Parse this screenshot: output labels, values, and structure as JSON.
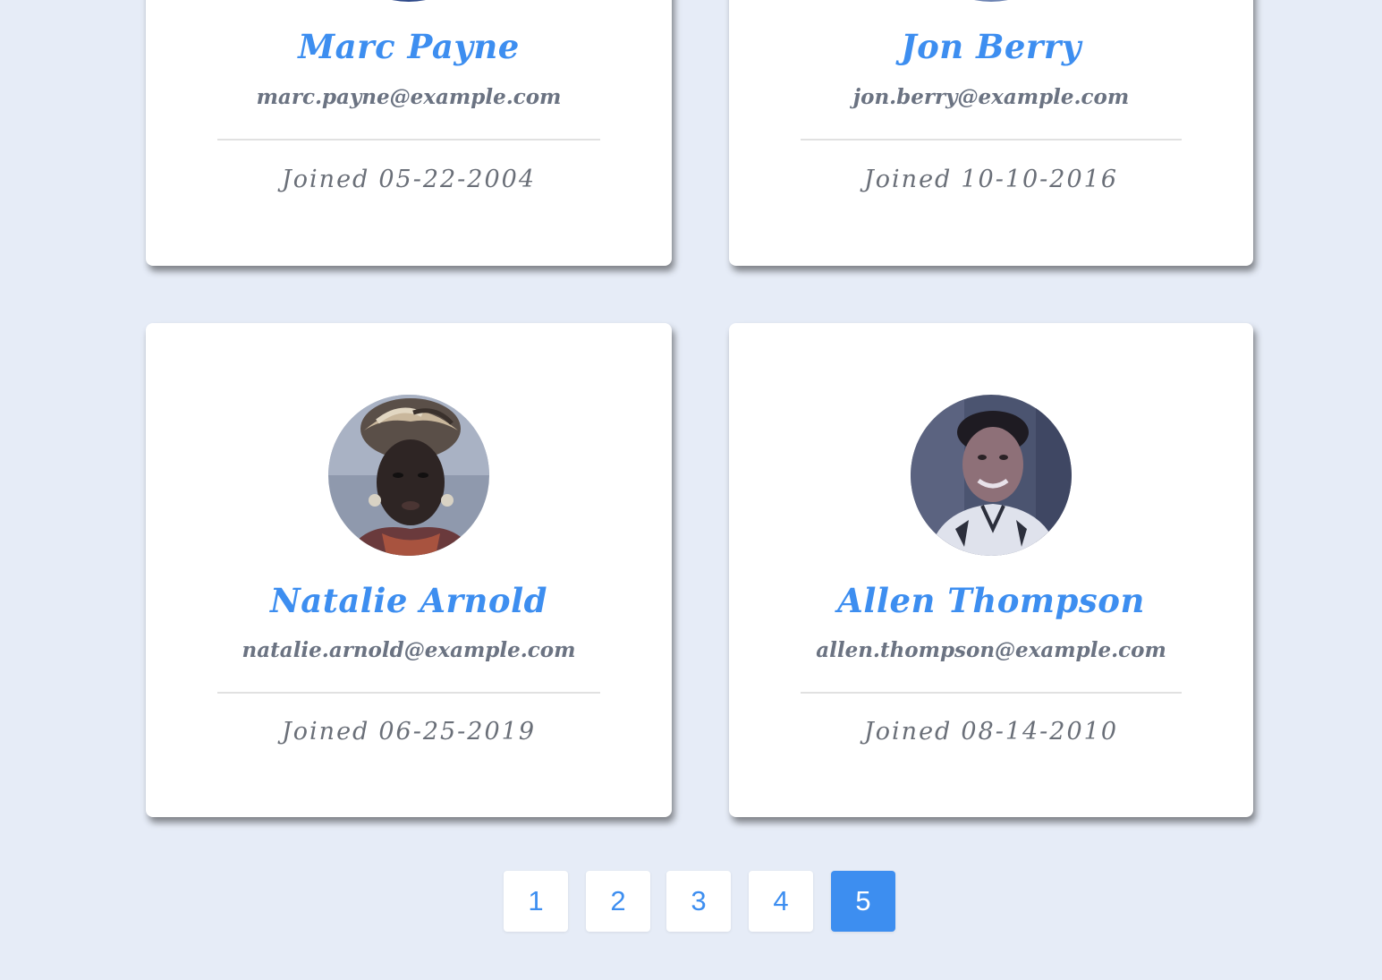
{
  "accent_color": "#3d8ef0",
  "background_color": "#e6ecf7",
  "users": [
    {
      "name": "Marc Payne",
      "email": "marc.payne@example.com",
      "joined_prefix": "Joined",
      "joined_date": "05-22-2004"
    },
    {
      "name": "Jon Berry",
      "email": "jon.berry@example.com",
      "joined_prefix": "Joined",
      "joined_date": "10-10-2016"
    },
    {
      "name": "Natalie Arnold",
      "email": "natalie.arnold@example.com",
      "joined_prefix": "Joined",
      "joined_date": "06-25-2019"
    },
    {
      "name": "Allen Thompson",
      "email": "allen.thompson@example.com",
      "joined_prefix": "Joined",
      "joined_date": "08-14-2010"
    }
  ],
  "pagination": {
    "pages": [
      "1",
      "2",
      "3",
      "4",
      "5"
    ],
    "current_page": "5"
  }
}
